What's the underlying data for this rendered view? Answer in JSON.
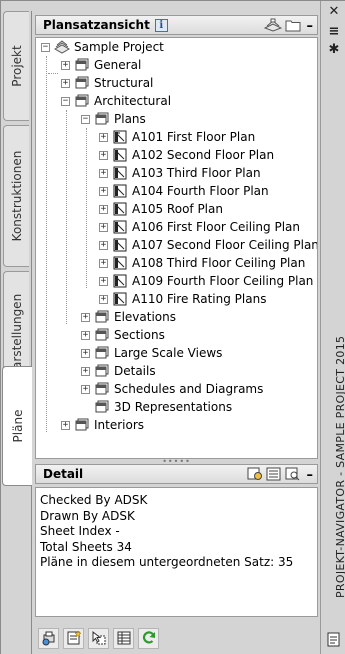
{
  "left_tabs": [
    {
      "label": "Projekt",
      "active": false
    },
    {
      "label": "Konstruktionen",
      "active": false
    },
    {
      "label": "Darstellungen",
      "active": false
    },
    {
      "label": "Pläne",
      "active": true
    }
  ],
  "sheet_set_view": {
    "header": "Plansatzansicht",
    "info_glyph": "i"
  },
  "tree": {
    "root": "Sample Project",
    "general": "General",
    "structural": "Structural",
    "architectural": "Architectural",
    "plans": "Plans",
    "sheets": [
      "A101 First Floor Plan",
      "A102 Second Floor Plan",
      "A103 Third Floor Plan",
      "A104 Fourth Floor Plan",
      "A105 Roof Plan",
      "A106 First Floor Ceiling Plan",
      "A107 Second Floor Ceiling Plan",
      "A108 Third Floor Ceiling Plan",
      "A109 Fourth Floor Ceiling Plan",
      "A110 Fire Rating Plans"
    ],
    "elevations": "Elevations",
    "sections": "Sections",
    "large_scale_views": "Large Scale Views",
    "details": "Details",
    "schedules": "Schedules and Diagrams",
    "representations_3d": "3D Representations",
    "interiors": "Interiors"
  },
  "detail": {
    "header": "Detail",
    "lines": [
      "Checked By ADSK",
      "Drawn By ADSK",
      "Sheet Index -",
      "Total Sheets 34",
      "Pläne in diesem untergeordneten Satz: 35"
    ]
  },
  "right_strip": {
    "title": "PROJEKT-NAVIGATOR - SAMPLE PROJECT 2015",
    "close_glyph": "✕",
    "collapse_glyph": "≡",
    "settings_glyph": "✱"
  },
  "colors": {
    "panel_bg": "#d4d4d4",
    "content_bg": "#ffffff",
    "border": "#9a9a9a",
    "refresh_green": "#2e9a2e"
  }
}
